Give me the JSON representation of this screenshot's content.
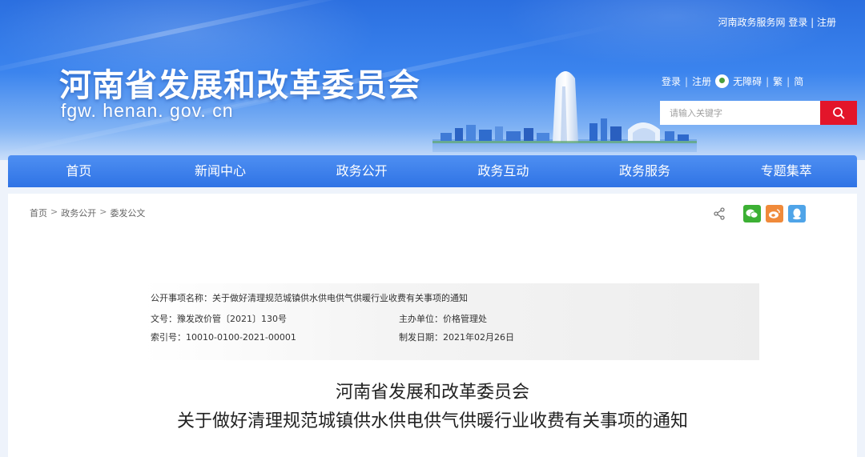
{
  "header": {
    "site_title": "河南省发展和改革委员会",
    "site_domain": "fgw. henan. gov. cn",
    "top_link": "河南政务服务网 登录 | 注册",
    "util": {
      "login": "登录",
      "register": "注册",
      "accessibility": "无障碍",
      "traditional": "繁",
      "simplified": "简"
    },
    "search": {
      "placeholder": "请输入关键字"
    }
  },
  "nav": {
    "items": [
      "首页",
      "新闻中心",
      "政务公开",
      "政务互动",
      "政务服务",
      "专题集萃"
    ]
  },
  "breadcrumb": [
    "首页",
    "政务公开",
    "委发公文"
  ],
  "meta": {
    "item_name_label": "公开事项名称：",
    "item_name": "关于做好清理规范城镇供水供电供气供暖行业收费有关事项的通知",
    "doc_no_label": "文号：",
    "doc_no": "豫发改价管〔2021〕130号",
    "dept_label": "主办单位：",
    "dept": "价格管理处",
    "index_label": "索引号：",
    "index": "10010-0100-2021-00001",
    "date_label": "制发日期：",
    "date": "2021年02月26日"
  },
  "document": {
    "title_line1": "河南省发展和改革委员会",
    "title_line2": "关于做好清理规范城镇供水供电供气供暖行业收费有关事项的通知"
  },
  "colors": {
    "nav_blue": "#2f73e5",
    "search_red": "#e3152a",
    "wechat_green": "#3cb034",
    "weibo_orange": "#f08a3a",
    "qq_blue": "#4fa4e8"
  },
  "icons": [
    "search-icon",
    "share-icon",
    "wechat-icon",
    "weibo-icon",
    "qq-icon",
    "accessibility-icon"
  ]
}
